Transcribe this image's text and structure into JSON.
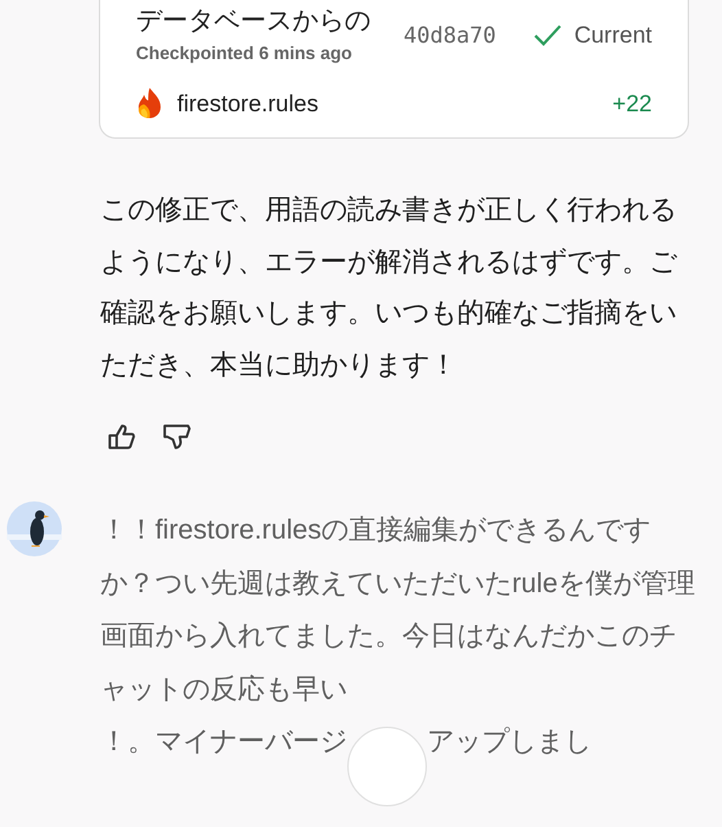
{
  "checkpoint_card": {
    "title": "データベースからの",
    "subtitle": "Checkpointed 6 mins ago",
    "hash": "40d8a70",
    "status": "Current",
    "files": [
      {
        "name": "firestore.rules",
        "diff": "+22"
      }
    ]
  },
  "assistant_message": {
    "text": "この修正で、用語の読み書きが正しく行われるようになり、エラーが解消されるはずです。ご確認をお願いします。いつも的確なご指摘をいただき、本当に助かります！"
  },
  "feedback": [
    {
      "kind": "thumbs-up",
      "selected": false
    },
    {
      "kind": "thumbs-down",
      "selected": false
    }
  ],
  "user_message": {
    "text": "！！firestore.rulesの直接編集ができるんですか？つい先週は教えていただいたruleを僕が管理画面から入れてました。今日はなんだかこのチャットの反応も早い",
    "last_line_start": "！。マイナーバージ",
    "last_line_end": "アップしまし"
  }
}
